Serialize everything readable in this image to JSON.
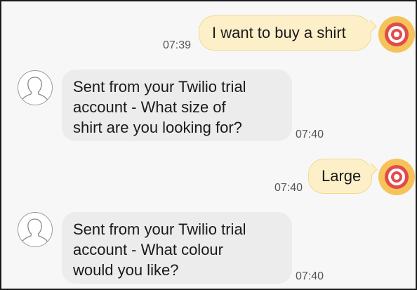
{
  "conversation": {
    "messages": [
      {
        "direction": "outgoing",
        "text": "I want to buy a shirt",
        "time": "07:39",
        "avatar_icon": "target-icon"
      },
      {
        "direction": "incoming",
        "lines": [
          "Sent from your Twilio trial",
          "account - What size of",
          "shirt are you looking for?"
        ],
        "time": "07:40",
        "avatar_icon": "person-outline-icon"
      },
      {
        "direction": "outgoing",
        "text": "Large",
        "time": "07:40",
        "avatar_icon": "target-icon"
      },
      {
        "direction": "incoming",
        "lines": [
          "Sent from your Twilio trial",
          "account - What colour",
          "would you like?"
        ],
        "time": "07:40",
        "avatar_icon": "person-outline-icon"
      }
    ]
  },
  "colors": {
    "outgoing_bubble": "#fdf0c9",
    "incoming_bubble": "#ececec",
    "target_ring_red": "#e24b4b",
    "target_bg_yellow": "#f6c35a",
    "background": "#f7f7f7"
  }
}
